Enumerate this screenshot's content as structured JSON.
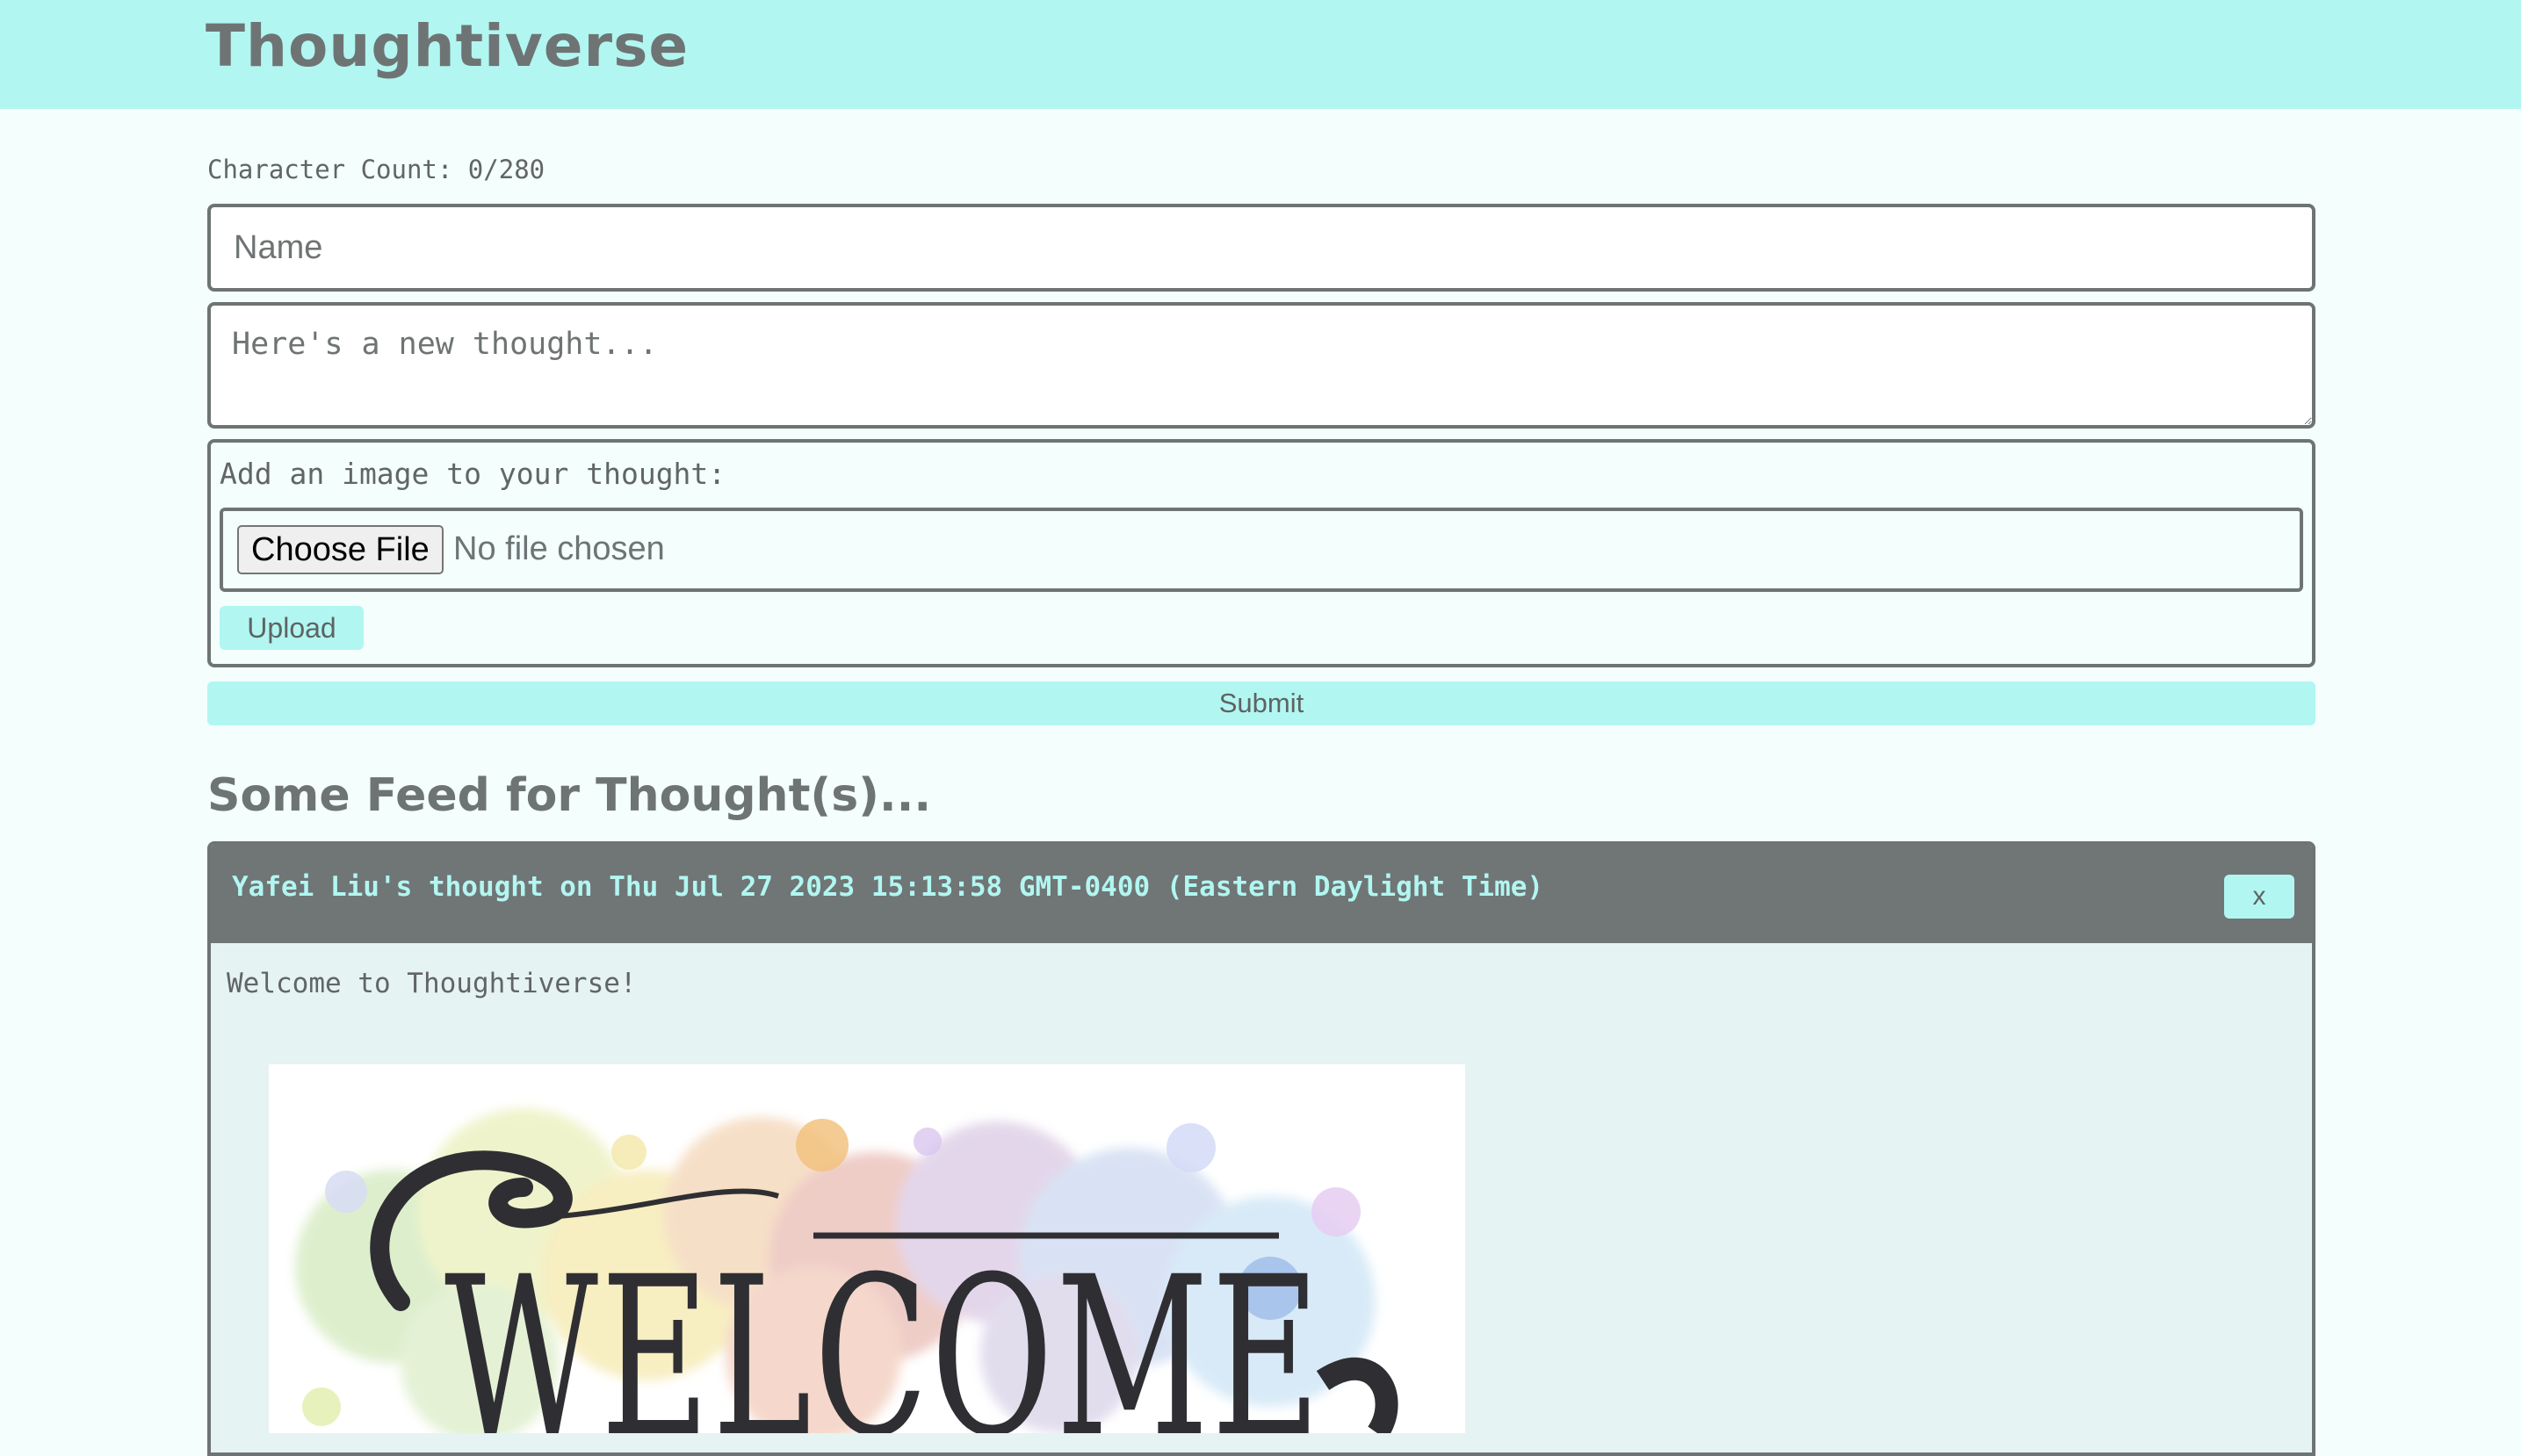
{
  "header": {
    "title": "Thoughtiverse"
  },
  "form": {
    "char_count": "Character Count: 0/280",
    "name_placeholder": "Name",
    "thought_placeholder": "Here's a new thought...",
    "image_label": "Add an image to your thought:",
    "choose_file_label": "Choose File",
    "no_file_text": "No file chosen",
    "upload_label": "Upload",
    "submit_label": "Submit"
  },
  "feed": {
    "title": "Some Feed for Thought(s)...",
    "thoughts": [
      {
        "meta": "Yafei Liu's thought on Thu Jul 27 2023 15:13:58 GMT-0400 (Eastern Daylight Time)",
        "delete_label": "x",
        "text": "Welcome to Thoughtiverse!",
        "image_text": "WELCOME"
      }
    ]
  },
  "colors": {
    "accent": "#b1f6f1",
    "background": "#f3fefd",
    "card_header": "#707575",
    "card_body": "#e5f3f2",
    "text": "#6e7373"
  }
}
